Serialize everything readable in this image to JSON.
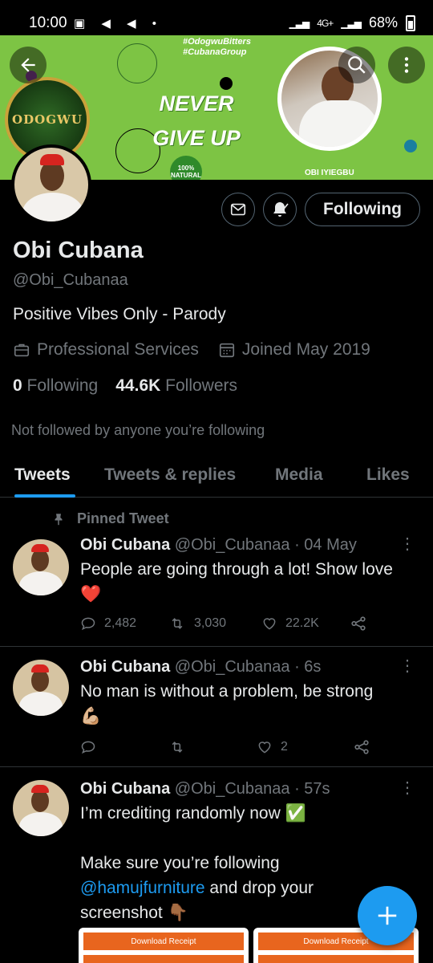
{
  "status_bar": {
    "time": "10:00",
    "network": "4G+",
    "battery": "68%"
  },
  "banner": {
    "hashtags": [
      "#OdogwuBitters",
      "#CubanaGroup"
    ],
    "headline_line1": "NEVER",
    "headline_line2": "GIVE UP",
    "logo_text": "ODOGWU",
    "badge_text_top": "100%",
    "badge_text_bottom": "NATURAL",
    "portrait_label": "OBI IYIEGBU",
    "bg_color": "#7dc444"
  },
  "profile": {
    "display_name": "Obi Cubana",
    "handle": "@Obi_Cubanaa",
    "bio": "Positive Vibes Only - Parody",
    "category": "Professional Services",
    "joined": "Joined May 2019",
    "following_count": "0",
    "following_label": "Following",
    "followers_count": "44.6K",
    "followers_label": "Followers",
    "not_followed_text": "Not followed by anyone you’re following",
    "following_button_label": "Following"
  },
  "tabs": [
    {
      "label": "Tweets",
      "active": true
    },
    {
      "label": "Tweets & replies",
      "active": false
    },
    {
      "label": "Media",
      "active": false
    },
    {
      "label": "Likes",
      "active": false
    }
  ],
  "tweets": [
    {
      "pinned_label": "Pinned Tweet",
      "name": "Obi Cubana",
      "handle_time": "@Obi_Cubanaa · 04 May",
      "text": "People are going through a lot! Show love",
      "emoji": "❤️",
      "replies": "2,482",
      "retweets": "3,030",
      "likes": "22.2K"
    },
    {
      "name": "Obi Cubana",
      "handle_time": "@Obi_Cubanaa · 6s",
      "text": "No man is without a problem, be strong",
      "emoji": "💪🏼",
      "replies": "",
      "retweets": "",
      "likes": "2"
    },
    {
      "name": "Obi Cubana",
      "handle_time": "@Obi_Cubanaa · 57s",
      "text_line1": "I’m crediting randomly now ✅",
      "text_line2": "Make sure you’re following",
      "mention": "@hamujfurniture",
      "text_line3": " and drop your",
      "text_line4": "screenshot 👇🏾",
      "receipt_label_1": "Download Receipt",
      "receipt_label_2": "Download Receipt"
    }
  ],
  "colors": {
    "accent": "#1d9bf0",
    "background": "#000000",
    "muted": "#71767b",
    "text": "#e7e9ea"
  }
}
